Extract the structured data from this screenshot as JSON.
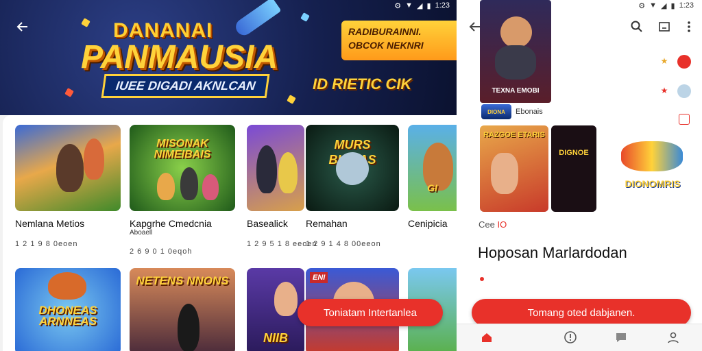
{
  "status_time": "1:23",
  "left_screen": {
    "back_label": "←",
    "banner": {
      "title_top": "DANANAI",
      "title_main": "PANMAUSIA",
      "ribbon": "IUEE DIGADI AKNLCAN",
      "cta": "RADIBURAINNI.",
      "cta_sub": "OBCOK NEKNRI",
      "subtitle": "ID RIETIC CIK"
    },
    "cards": [
      {
        "title": "Nemlana Metios",
        "sub": "",
        "meta": "1 2 1 9 8 0eoen",
        "art": ""
      },
      {
        "title": "Kapgrhe Cmedcnia",
        "sub": "Aboaell",
        "meta": "2 6 9 0 1 0eqoh",
        "art": "MISONAK NIMEIBAIS"
      },
      {
        "title": "Basealick",
        "sub": "",
        "meta": "1 2 9 5 1 8 eeoen",
        "art": ""
      },
      {
        "title": "Remahan",
        "sub": "",
        "meta": "1 2 9 1 4 8 00eeon",
        "art": "MURS BUBIAS"
      },
      {
        "title": "Cenipicia",
        "sub": "",
        "meta": "",
        "art": "GI"
      },
      {
        "title": "",
        "sub": "",
        "meta": "",
        "art": "DHONEAS ARNNEAS"
      },
      {
        "title": "",
        "sub": "",
        "meta": "",
        "art": "NETENS NNONS"
      },
      {
        "title": "",
        "sub": "",
        "meta": "",
        "art": "NIIB"
      },
      {
        "title": "",
        "sub": "",
        "meta": "",
        "art": "ENI"
      },
      {
        "title": "",
        "sub": "",
        "meta": "",
        "art": ""
      }
    ],
    "fab_label": "Toniatam Intertanlea"
  },
  "right_screen": {
    "poster_text": "TEXNA EMOBI",
    "developer": "Ebonais",
    "developer_logo": "DIONA",
    "shot_text_1": "RAZGOE ETARIS",
    "shot_text_2": "DIGNOE",
    "shot_text_3": "DIONOMRIS",
    "rating": "Cee",
    "rating_value": "IO",
    "title": "Hoposan Marlardodan",
    "fab_label": "Tomang oted dabjanen."
  },
  "colors": {
    "accent": "#e8312a",
    "banner_gold": "#ffd23a",
    "banner_navy": "#15204f"
  },
  "icons": [
    "back-arrow-icon",
    "search-icon",
    "cast-icon",
    "more-vert-icon",
    "star-icon",
    "home-icon",
    "info-icon",
    "chat-icon",
    "profile-icon"
  ]
}
